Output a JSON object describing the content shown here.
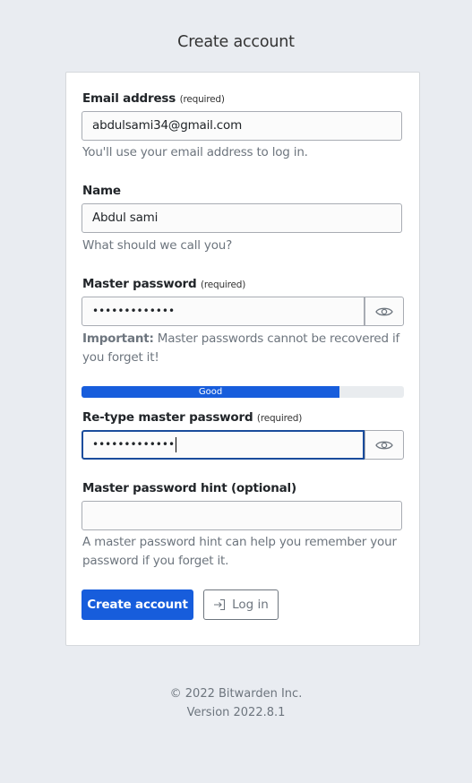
{
  "page": {
    "title": "Create account"
  },
  "form": {
    "email": {
      "label": "Email address",
      "required": "(required)",
      "value": "abdulsami34@gmail.com",
      "help": "You'll use your email address to log in."
    },
    "name": {
      "label": "Name",
      "value": "Abdul sami",
      "help": "What should we call you?"
    },
    "master_password": {
      "label": "Master password",
      "required": "(required)",
      "value": "•••••••••••••",
      "help_strong": "Important:",
      "help": " Master passwords cannot be recovered if you forget it!",
      "toggle_icon": "eye-icon"
    },
    "strength": {
      "label": "Good",
      "percent": 80,
      "color": "#175ddc"
    },
    "retype_password": {
      "label": "Re-type master password",
      "required": "(required)",
      "value": "•••••••••••••",
      "toggle_icon": "eye-icon"
    },
    "hint": {
      "label": "Master password hint (optional)",
      "value": "",
      "help": "A master password hint can help you remember your password if you forget it."
    },
    "buttons": {
      "create": "Create account",
      "login": "Log in",
      "login_icon": "sign-in-icon"
    }
  },
  "footer": {
    "copyright": "© 2022 Bitwarden Inc.",
    "version": "Version 2022.8.1"
  },
  "colors": {
    "primary": "#175ddc",
    "background": "#e9ecf1"
  }
}
